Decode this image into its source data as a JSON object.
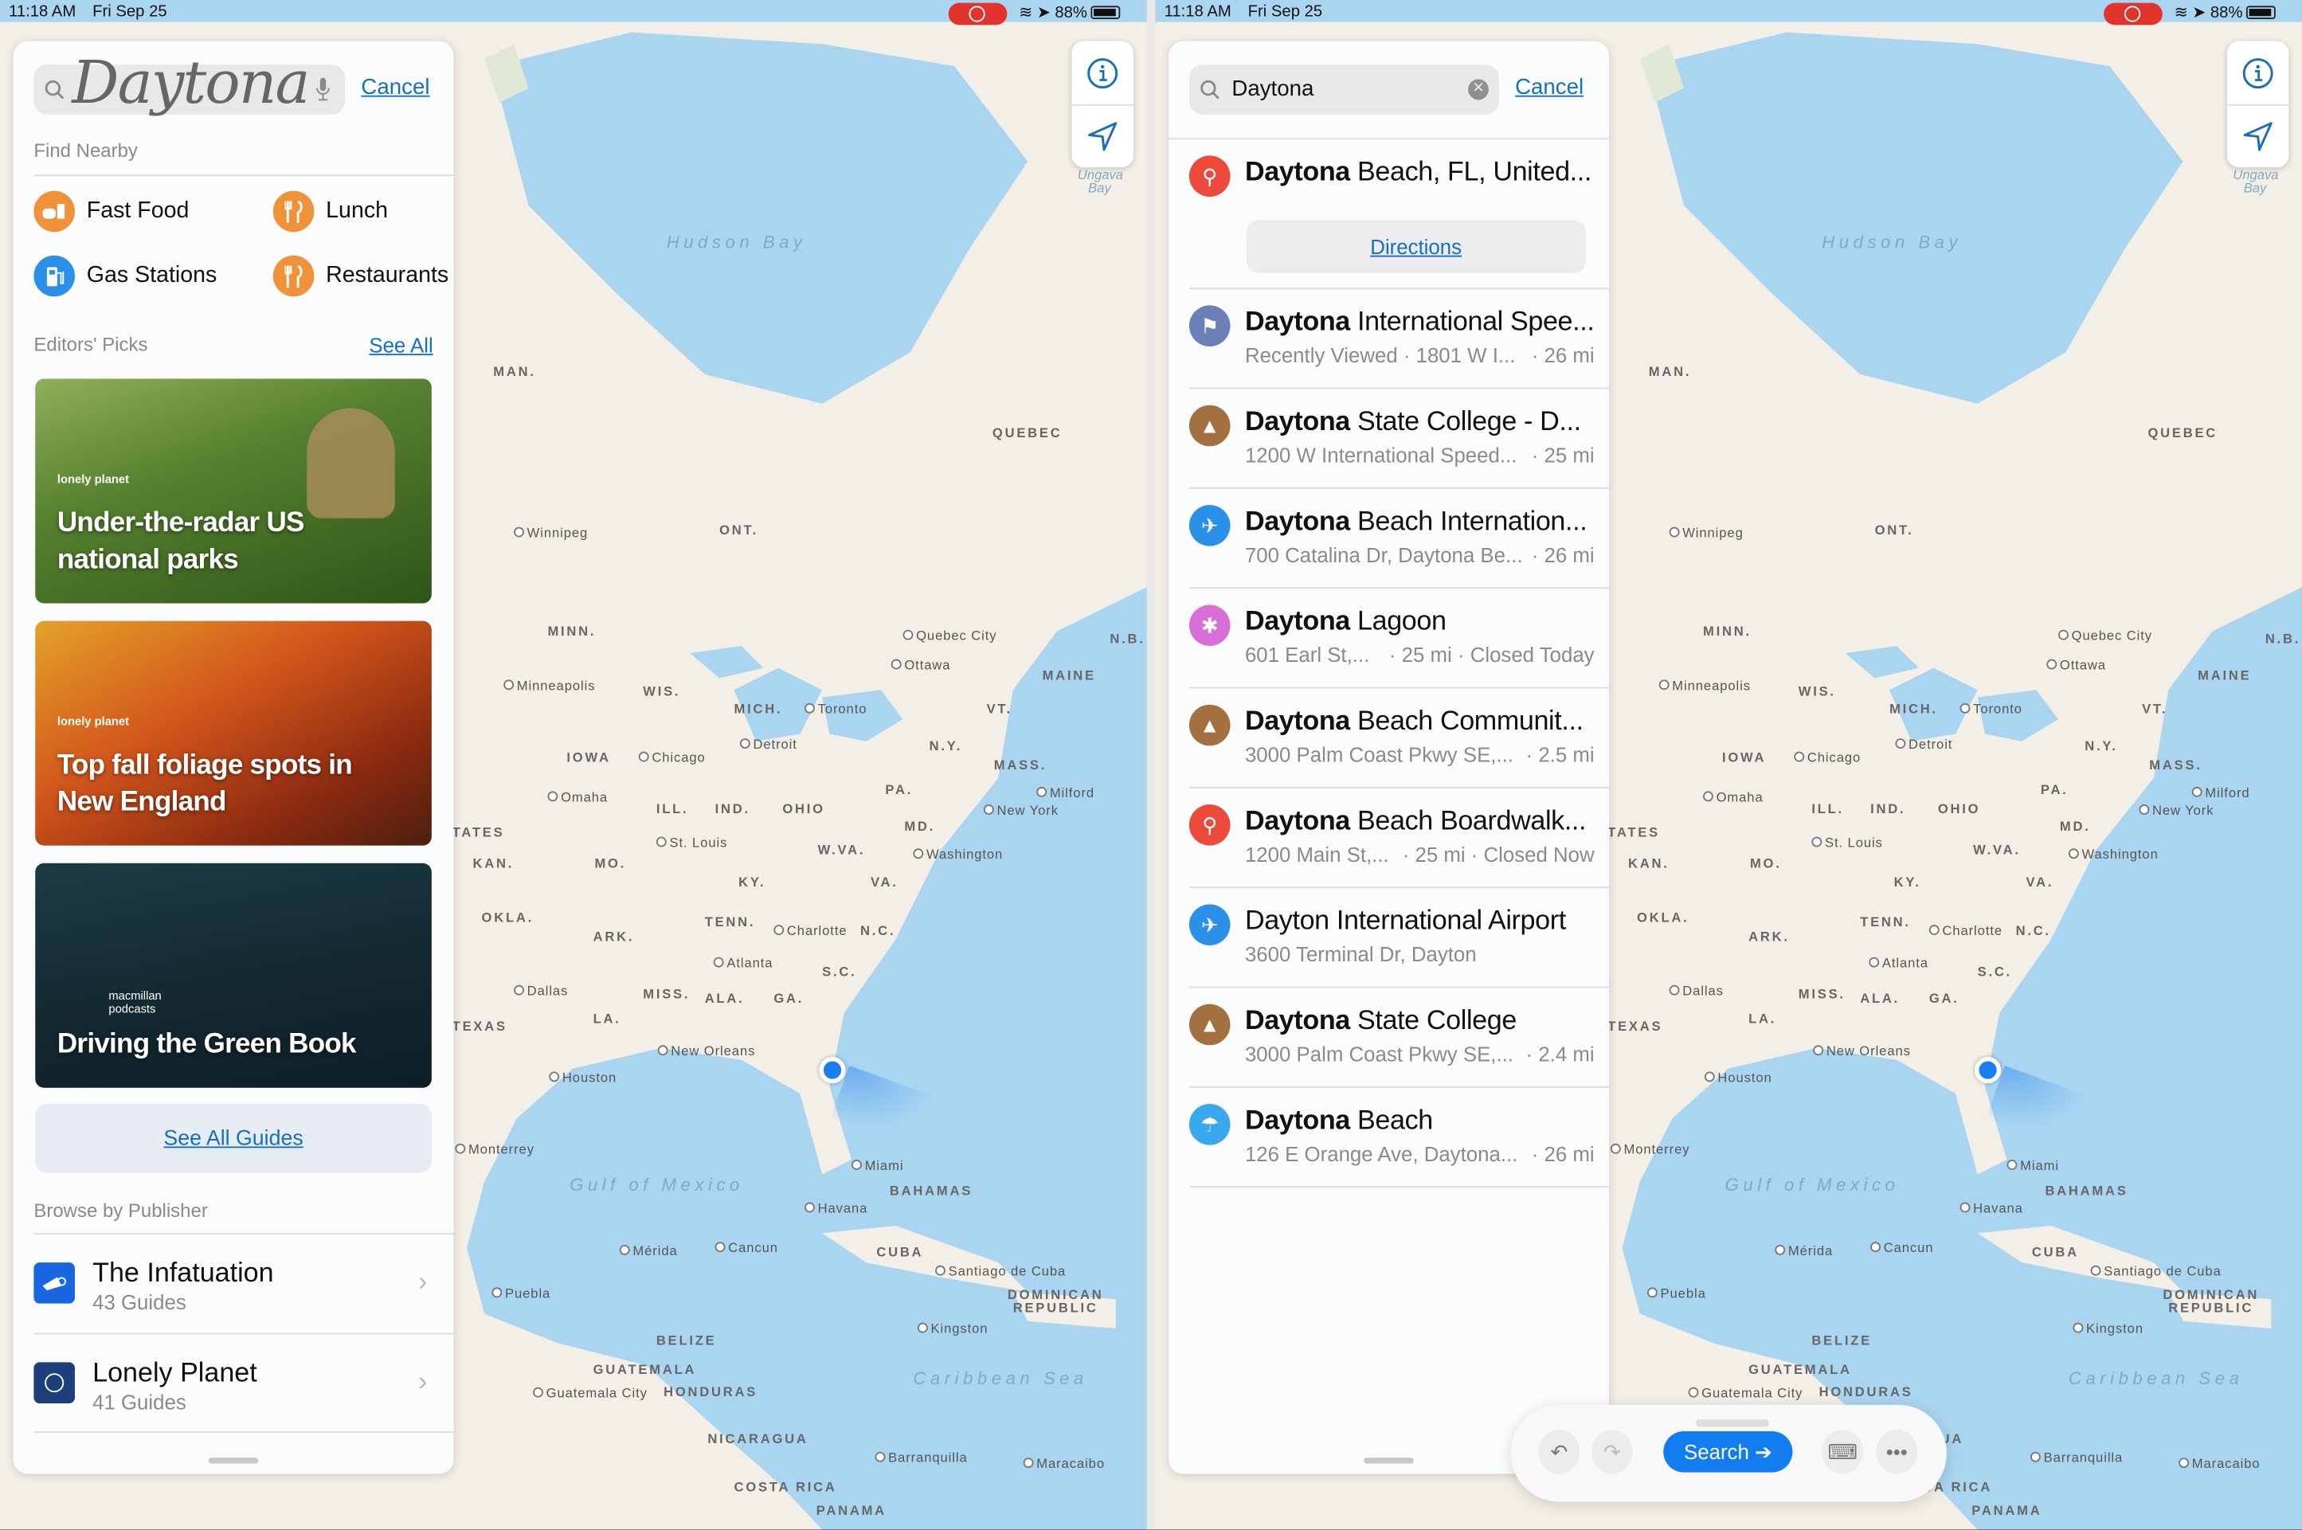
{
  "status_bar": {
    "time": "11:18 AM",
    "date": "Fri Sep 25",
    "battery": "88%"
  },
  "colors": {
    "accent": "#1470c4",
    "search_button": "#127df0",
    "record": "#e0342c",
    "orange_poi": "#f0923a",
    "blue_poi": "#2b90e8",
    "red_pin": "#ec4b3c",
    "speedway": "#6b7fb8",
    "education": "#a3703f",
    "amusement": "#d86fd8",
    "beach": "#3aa8ec"
  },
  "map_controls": {
    "info_icon": "info-circle-icon",
    "location_icon": "location-arrow-icon"
  },
  "map_labels": [
    "Hudson Bay",
    "Ungava Bay",
    "QUEBEC",
    "MAN.",
    "ONT.",
    "Winnipeg",
    "MINN.",
    "Quebec City",
    "N.B.",
    "Ottawa",
    "MAINE",
    "Minneapolis",
    "WIS.",
    "MICH.",
    "Toronto",
    "VT.",
    "N.Y.",
    "MASS.",
    "Milford",
    "New York",
    "Detroit",
    "Chicago",
    "IOWA",
    "Omaha",
    "ILL.",
    "IND.",
    "OHIO",
    "PA.",
    "MD.",
    "Washington",
    "St. Louis",
    "W.VA.",
    "VA.",
    "KAN.",
    "MO.",
    "KY.",
    "TATES",
    "OKLA.",
    "TENN.",
    "Charlotte",
    "N.C.",
    "ARK.",
    "Atlanta",
    "S.C.",
    "Dallas",
    "MISS.",
    "ALA.",
    "GA.",
    "TEXAS",
    "LA.",
    "New Orleans",
    "Houston",
    "Monterrey",
    "Gulf of Mexico",
    "Miami",
    "BAHAMAS",
    "Havana",
    "Mérida",
    "Cancun",
    "CUBA",
    "Santiago de Cuba",
    "DOMINICAN REPUBLIC",
    "Puebla",
    "Kingston",
    "BELIZE",
    "GUATEMALA",
    "Guatemala City",
    "HONDURAS",
    "Caribbean Sea",
    "NICARAGUA",
    "Barranquilla",
    "Maracaibo",
    "COSTA RICA",
    "PANAMA"
  ],
  "left": {
    "search": {
      "handwritten_value": "Daytona",
      "cancel": "Cancel",
      "search_icon": "magnifier-icon",
      "mic_icon": "microphone-icon"
    },
    "find_nearby": {
      "label": "Find Nearby",
      "items": [
        {
          "label": "Fast Food",
          "icon": "fast-food-icon"
        },
        {
          "label": "Lunch",
          "icon": "fork-knife-icon"
        },
        {
          "label": "Gas Stations",
          "icon": "gas-pump-icon"
        },
        {
          "label": "Restaurants",
          "icon": "fork-knife-icon"
        }
      ]
    },
    "editors_picks": {
      "label": "Editors' Picks",
      "see_all": "See All",
      "cards": [
        {
          "title": "Under-the-radar US national parks",
          "publisher_logo": "lonely planet"
        },
        {
          "title": "Top fall foliage spots in New England",
          "publisher_logo": "lonely planet"
        },
        {
          "title": "Driving the Green Book",
          "publisher_logo": "macmillan podcasts"
        }
      ],
      "see_all_guides": "See All Guides"
    },
    "browse_by_publisher": {
      "label": "Browse by Publisher",
      "publishers": [
        {
          "name": "The Infatuation",
          "count": "43 Guides"
        },
        {
          "name": "Lonely Planet",
          "count": "41 Guides"
        }
      ]
    }
  },
  "right": {
    "search": {
      "value": "Daytona",
      "cancel": "Cancel"
    },
    "directions": "Directions",
    "results": [
      {
        "bold": "Daytona",
        "rest": " Beach, FL, United...",
        "sub_left": "",
        "sub_right": "",
        "icon": "pin-icon"
      },
      {
        "bold": "Daytona",
        "rest": " International Spee...",
        "sub_left": "Recently Viewed · 1801 W I...",
        "sub_right": "· 26 mi",
        "icon": "checkered-flags-icon"
      },
      {
        "bold": "Daytona",
        "rest": " State College - D...",
        "sub_left": "1200 W International Speed...",
        "sub_right": "· 25 mi",
        "icon": "graduation-cap-icon"
      },
      {
        "bold": "Daytona",
        "rest": " Beach Internation...",
        "sub_left": "700 Catalina Dr, Daytona Be...",
        "sub_right": "· 26 mi",
        "icon": "airplane-icon"
      },
      {
        "bold": "Daytona",
        "rest": " Lagoon",
        "sub_left": "601 Earl St,...",
        "sub_right": "· 25 mi · Closed Today",
        "icon": "ferris-wheel-icon"
      },
      {
        "bold": "Daytona",
        "rest": " Beach Communit...",
        "sub_left": "3000 Palm Coast Pkwy SE,...",
        "sub_right": "· 2.5 mi",
        "icon": "graduation-cap-icon"
      },
      {
        "bold": "Daytona",
        "rest": " Beach Boardwalk...",
        "sub_left": "1200 Main St,...",
        "sub_right": "· 25 mi · Closed Now",
        "icon": "pin-icon"
      },
      {
        "bold": "",
        "rest": "Dayton International Airport",
        "sub_left": "3600 Terminal Dr, Dayton",
        "sub_right": "",
        "icon": "airplane-icon"
      },
      {
        "bold": "Daytona",
        "rest": " State College",
        "sub_left": "3000 Palm Coast Pkwy SE,...",
        "sub_right": "· 2.4 mi",
        "icon": "graduation-cap-icon"
      },
      {
        "bold": "Daytona",
        "rest": " Beach",
        "sub_left": "126 E Orange Ave, Daytona...",
        "sub_right": "· 26 mi",
        "icon": "beach-umbrella-icon"
      }
    ],
    "toolbar": {
      "search": "Search",
      "undo_icon": "undo-icon",
      "redo_icon": "redo-icon",
      "keyboard_icon": "keyboard-icon",
      "more_icon": "ellipsis-icon"
    }
  }
}
